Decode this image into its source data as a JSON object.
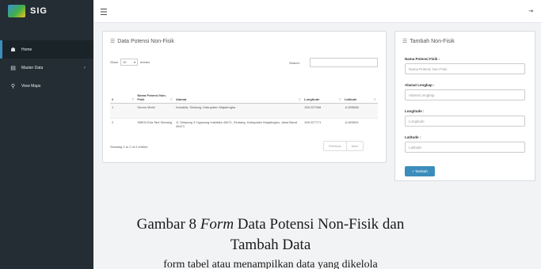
{
  "sidebar": {
    "brand": "SIG",
    "items": [
      {
        "icon": "home-icon",
        "label": "Home",
        "active": true
      },
      {
        "icon": "database-icon",
        "label": "Master Data",
        "has_submenu": true
      },
      {
        "icon": "map-marker-icon",
        "label": "View Maps"
      }
    ]
  },
  "topbar": {
    "menu_icon": "hamburger-icon",
    "right_icon": "expand-icon"
  },
  "table_panel": {
    "title": "Data Potensi Non-Fisik",
    "show_label": "Show",
    "entries_value": "10",
    "entries_label": "entries",
    "search_label": "Search:",
    "columns": [
      "#",
      "Nama Potensi Non-Fisik",
      "Alamat",
      "Longitude",
      "Latitude"
    ],
    "rows": [
      {
        "no": "1",
        "nama": "Sunan Mobil",
        "alamat": "Indrakila, Sindang, Kabupaten Majalengka",
        "longitude": "108.237968",
        "latitude": "-6.825880"
      },
      {
        "no": "2",
        "nama": "SMKN Eka Tani Sindang",
        "alamat": "Jl. Simpang 3 Cigasong Indrakila 45471, Sindang, Kabupaten Majalengka, Jawa Barat 45471",
        "longitude": "108.227771",
        "latitude": "-6.829501"
      }
    ],
    "info": "Showing 1 to 2 of 2 entries",
    "prev": "Previous",
    "next": "Next"
  },
  "form_panel": {
    "title": "Tambah Non-Fisik",
    "fields": [
      {
        "label": "Nama Potensi Fisik :",
        "placeholder": "Nama Potensi Non-Fisik"
      },
      {
        "label": "Alamat Lengkap :",
        "placeholder": "Alamat Lengkap"
      },
      {
        "label": "Longitude :",
        "placeholder": "Longitude"
      },
      {
        "label": "Latitude :",
        "placeholder": "Latitude"
      }
    ],
    "submit": "+ Tambah"
  },
  "caption": {
    "prefix": "Gambar 8 ",
    "italic": "Form",
    "rest": " Data Potensi Non-Fisik dan",
    "line2": "Tambah Data",
    "bottom": "form tabel atau menampilkan data yang dikelola"
  },
  "colors": {
    "sidebar": "#232d33",
    "accent": "#3c8dbc",
    "content_bg": "#f2f3f5"
  }
}
